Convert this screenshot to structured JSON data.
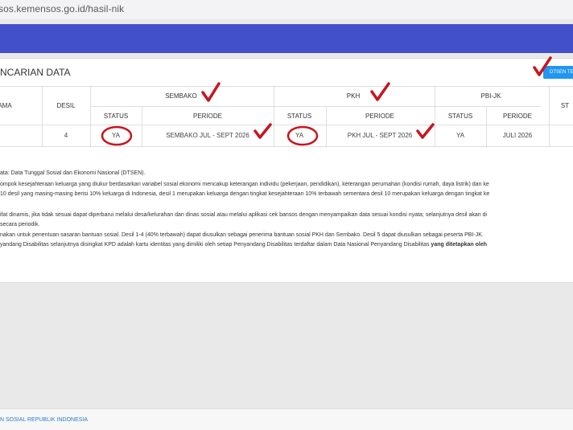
{
  "browser": {
    "url": "sos.kemensos.go.id/hasil-nik"
  },
  "card": {
    "title": "NCARIAN DATA",
    "dtsen_button": "DTSEN TE"
  },
  "table": {
    "headers": {
      "nama": "AMA",
      "desil": "DESIL",
      "sembako": "SEMBAKO",
      "pkh": "PKH",
      "pbijk": "PBI-JK",
      "last": "ST"
    },
    "subheaders": {
      "status": "STATUS",
      "periode": "PERIODE"
    },
    "row": {
      "desil": "4",
      "sembako_status": "YA",
      "sembako_periode": "SEMBAKO JUL - SEPT 2026",
      "pkh_status": "YA",
      "pkh_periode": "PKH JUL - SEPT 2026",
      "pbijk_status": "YA",
      "pbijk_periode": "JULI 2026"
    }
  },
  "notes": {
    "n1": "ata: Data Tunggal Sosial dan Ekonomi Nasional (DTSEN).",
    "n2": "ompok kesejahteraan keluarga yang diukur berdasarkan variabel sosial ekonomi mencakup keterangan individu (pekerjaan, pendidikan), keterangan perumahan (kondisi rumah, daya listrik) dan ke",
    "n3": "10 desil yang masing-masing berisi 10% keluarga di Indonesia, desil 1 merupakan keluarga dengan tingkat kesejahteraan 10% terbawah sementara desil 10 merupakan keluarga dengan tingkat ke",
    "n4": "ifat dinamis, jika tidak sesuai dapat diperbarui melalui desa/kelurahan dan dinas sosial atau melalui aplikasi cek bansos dengan menyampaikan data sesuai kondisi nyata; selanjutnya desil akan di",
    "n5": "secara periodik.",
    "n6": "nakan untuk penentuan sasaran bantuan sosial. Desil 1-4 (40% terbawah) dapat diusulkan sebagai penerima bantuan sosial PKH dan Sembako. Desil 5 dapat diusulkan sebagai peserta PBI-JK.",
    "n7": "yandang Disabilitas selanjutnya disingkat KPD adalah kartu identitas yang dimiliki oleh setiap Penyandang Disabilitas terdaftar dalam Data Nasional Penyandang Disabilitas ",
    "n7_bold": "yang ditetapkan oleh"
  },
  "footer": {
    "text": "N SOSIAL REPUBLIK INDONESIA"
  },
  "colors": {
    "nav": "#4250c9",
    "button": "#2196f3",
    "ink": "#c8141e",
    "footer_link": "#2a7cc7"
  }
}
